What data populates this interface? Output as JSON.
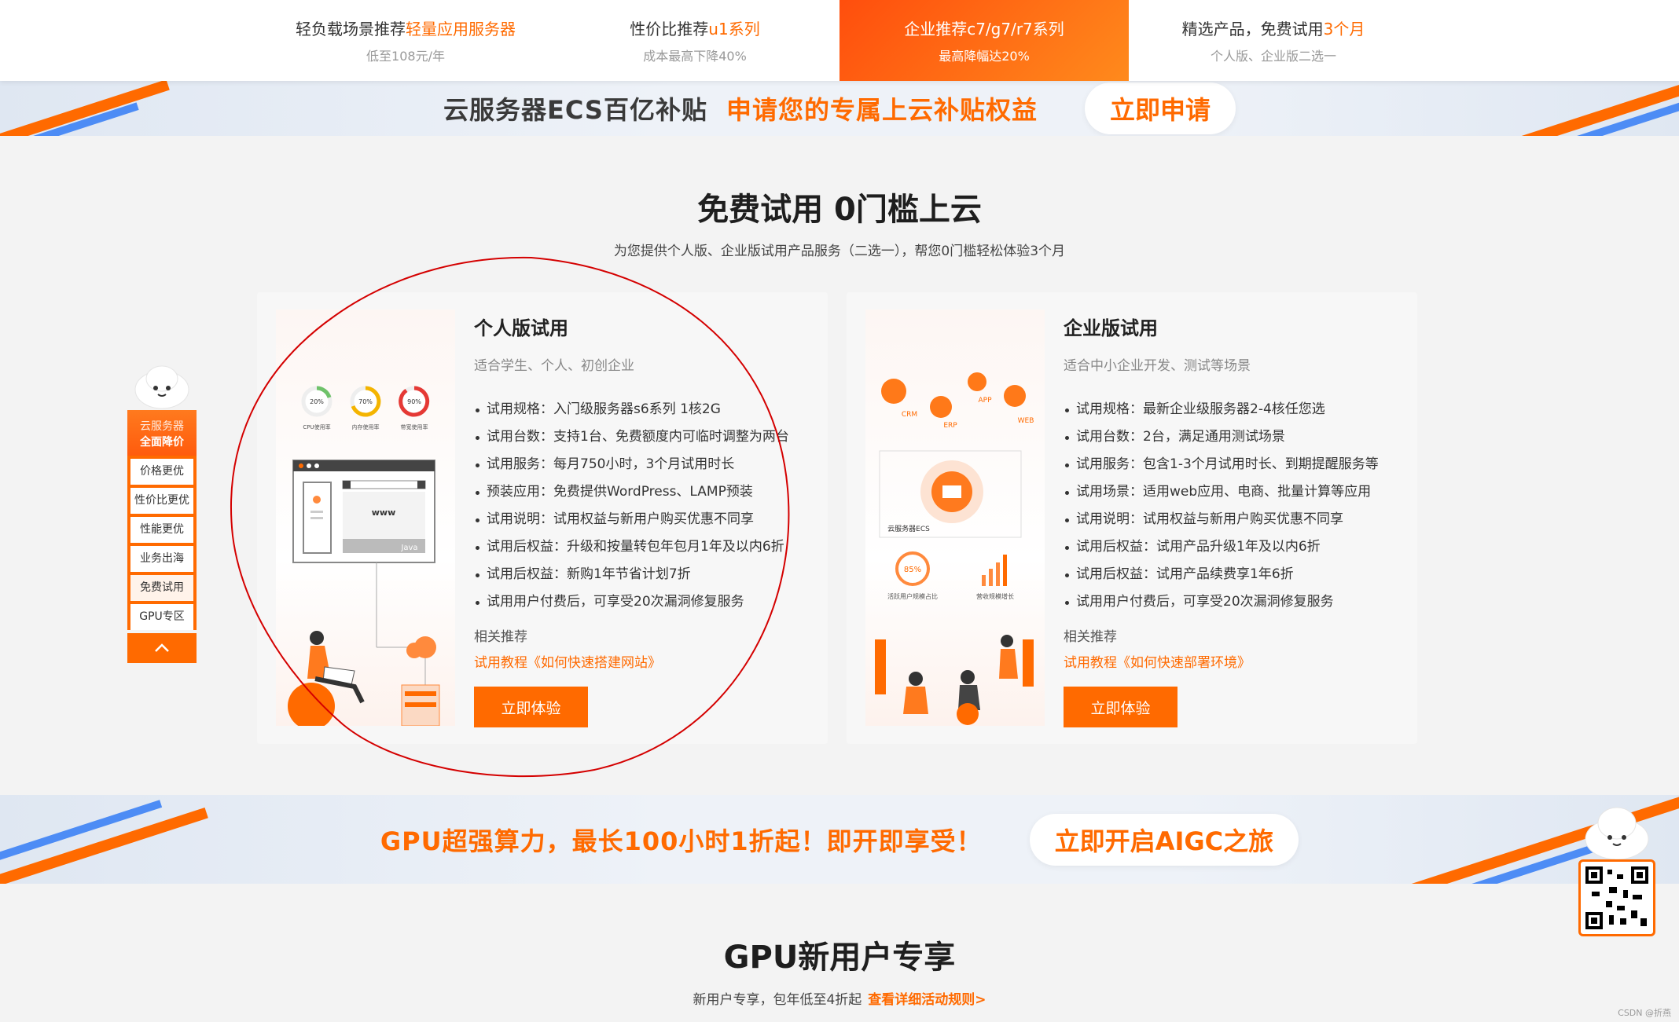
{
  "tabs": [
    {
      "title": "轻负载场景推荐",
      "highlight": "轻量应用服务器",
      "sub": "低至108元/年",
      "active": false
    },
    {
      "title": "性价比推荐",
      "highlight": "u1系列",
      "sub": "成本最高下降40%",
      "active": false
    },
    {
      "title": "企业推荐",
      "highlight": "c7/g7/r7系列",
      "sub": "最高降幅达20%",
      "active": true
    },
    {
      "title": "精选产品，免费试用",
      "highlight": "3个月",
      "sub": "个人版、企业版二选一",
      "active": false
    }
  ],
  "banner_top": {
    "text_dark": "云服务器ECS百亿补贴",
    "text_orange": "申请您的专属上云补贴权益",
    "button": "立即申请"
  },
  "free_trial": {
    "title": "免费试用 0门槛上云",
    "subtitle": "为您提供个人版、企业版试用产品服务（二选一），帮您0门槛轻松体验3个月"
  },
  "cards": [
    {
      "title": "个人版试用",
      "desc": "适合学生、个人、初创企业",
      "items": [
        "试用规格：入门级服务器s6系列 1核2G",
        "试用台数：支持1台、免费额度内可临时调整为两台",
        "试用服务：每月750小时，3个月试用时长",
        "预装应用：免费提供WordPress、LAMP预装",
        "试用说明：试用权益与新用户购买优惠不同享",
        "试用后权益：升级和按量转包年包月1年及以内6折",
        "试用后权益：新购1年节省计划7折",
        "试用用户付费后，可享受20次漏洞修复服务"
      ],
      "related_title": "相关推荐",
      "related_link": "试用教程《如何快速搭建网站》",
      "button": "立即体验",
      "illus": {
        "gauges": [
          "20%",
          "70%",
          "90%"
        ],
        "gauge_labels": [
          "CPU使用率",
          "内存使用率",
          "带宽使用率"
        ],
        "www": "www",
        "java": "Java"
      }
    },
    {
      "title": "企业版试用",
      "desc": "适合中小企业开发、测试等场景",
      "items": [
        "试用规格：最新企业级服务器2-4核任您选",
        "试用台数：2台，满足通用测试场景",
        "试用服务：包含1-3个月试用时长、到期提醒服务等",
        "试用场景：适用web应用、电商、批量计算等应用",
        "试用说明：试用权益与新用户购买优惠不同享",
        "试用后权益：试用产品升级1年及以内6折",
        "试用后权益：试用产品续费享1年6折",
        "试用用户付费后，可享受20次漏洞修复服务"
      ],
      "related_title": "相关推荐",
      "related_link": "试用教程《如何快速部署环境》",
      "button": "立即体验",
      "illus": {
        "tags": [
          "CRM",
          "ERP",
          "APP",
          "WEB"
        ],
        "center": "云服务器ECS",
        "pct": "85%",
        "label_a": "活跃用户规模占比",
        "label_b": "营收规模增长"
      }
    }
  ],
  "sidenav": {
    "head_a": "云服务器",
    "head_b": "全面降价",
    "items": [
      "价格更优",
      "性价比更优",
      "性能更优",
      "业务出海",
      "免费试用",
      "GPU专区"
    ],
    "selected": "免费试用"
  },
  "banner_gpu": {
    "text": "GPU超强算力，最长100小时1折起！即开即享受！",
    "button": "立即开启AIGC之旅"
  },
  "gpu_section": {
    "title": "GPU新用户专享",
    "subtitle": "新用户专享，包年低至4折起",
    "link": "查看详细活动规则>"
  },
  "watermark": "CSDN @折燕",
  "colors": {
    "accent": "#ff6a00",
    "annotation": "#d40000"
  }
}
